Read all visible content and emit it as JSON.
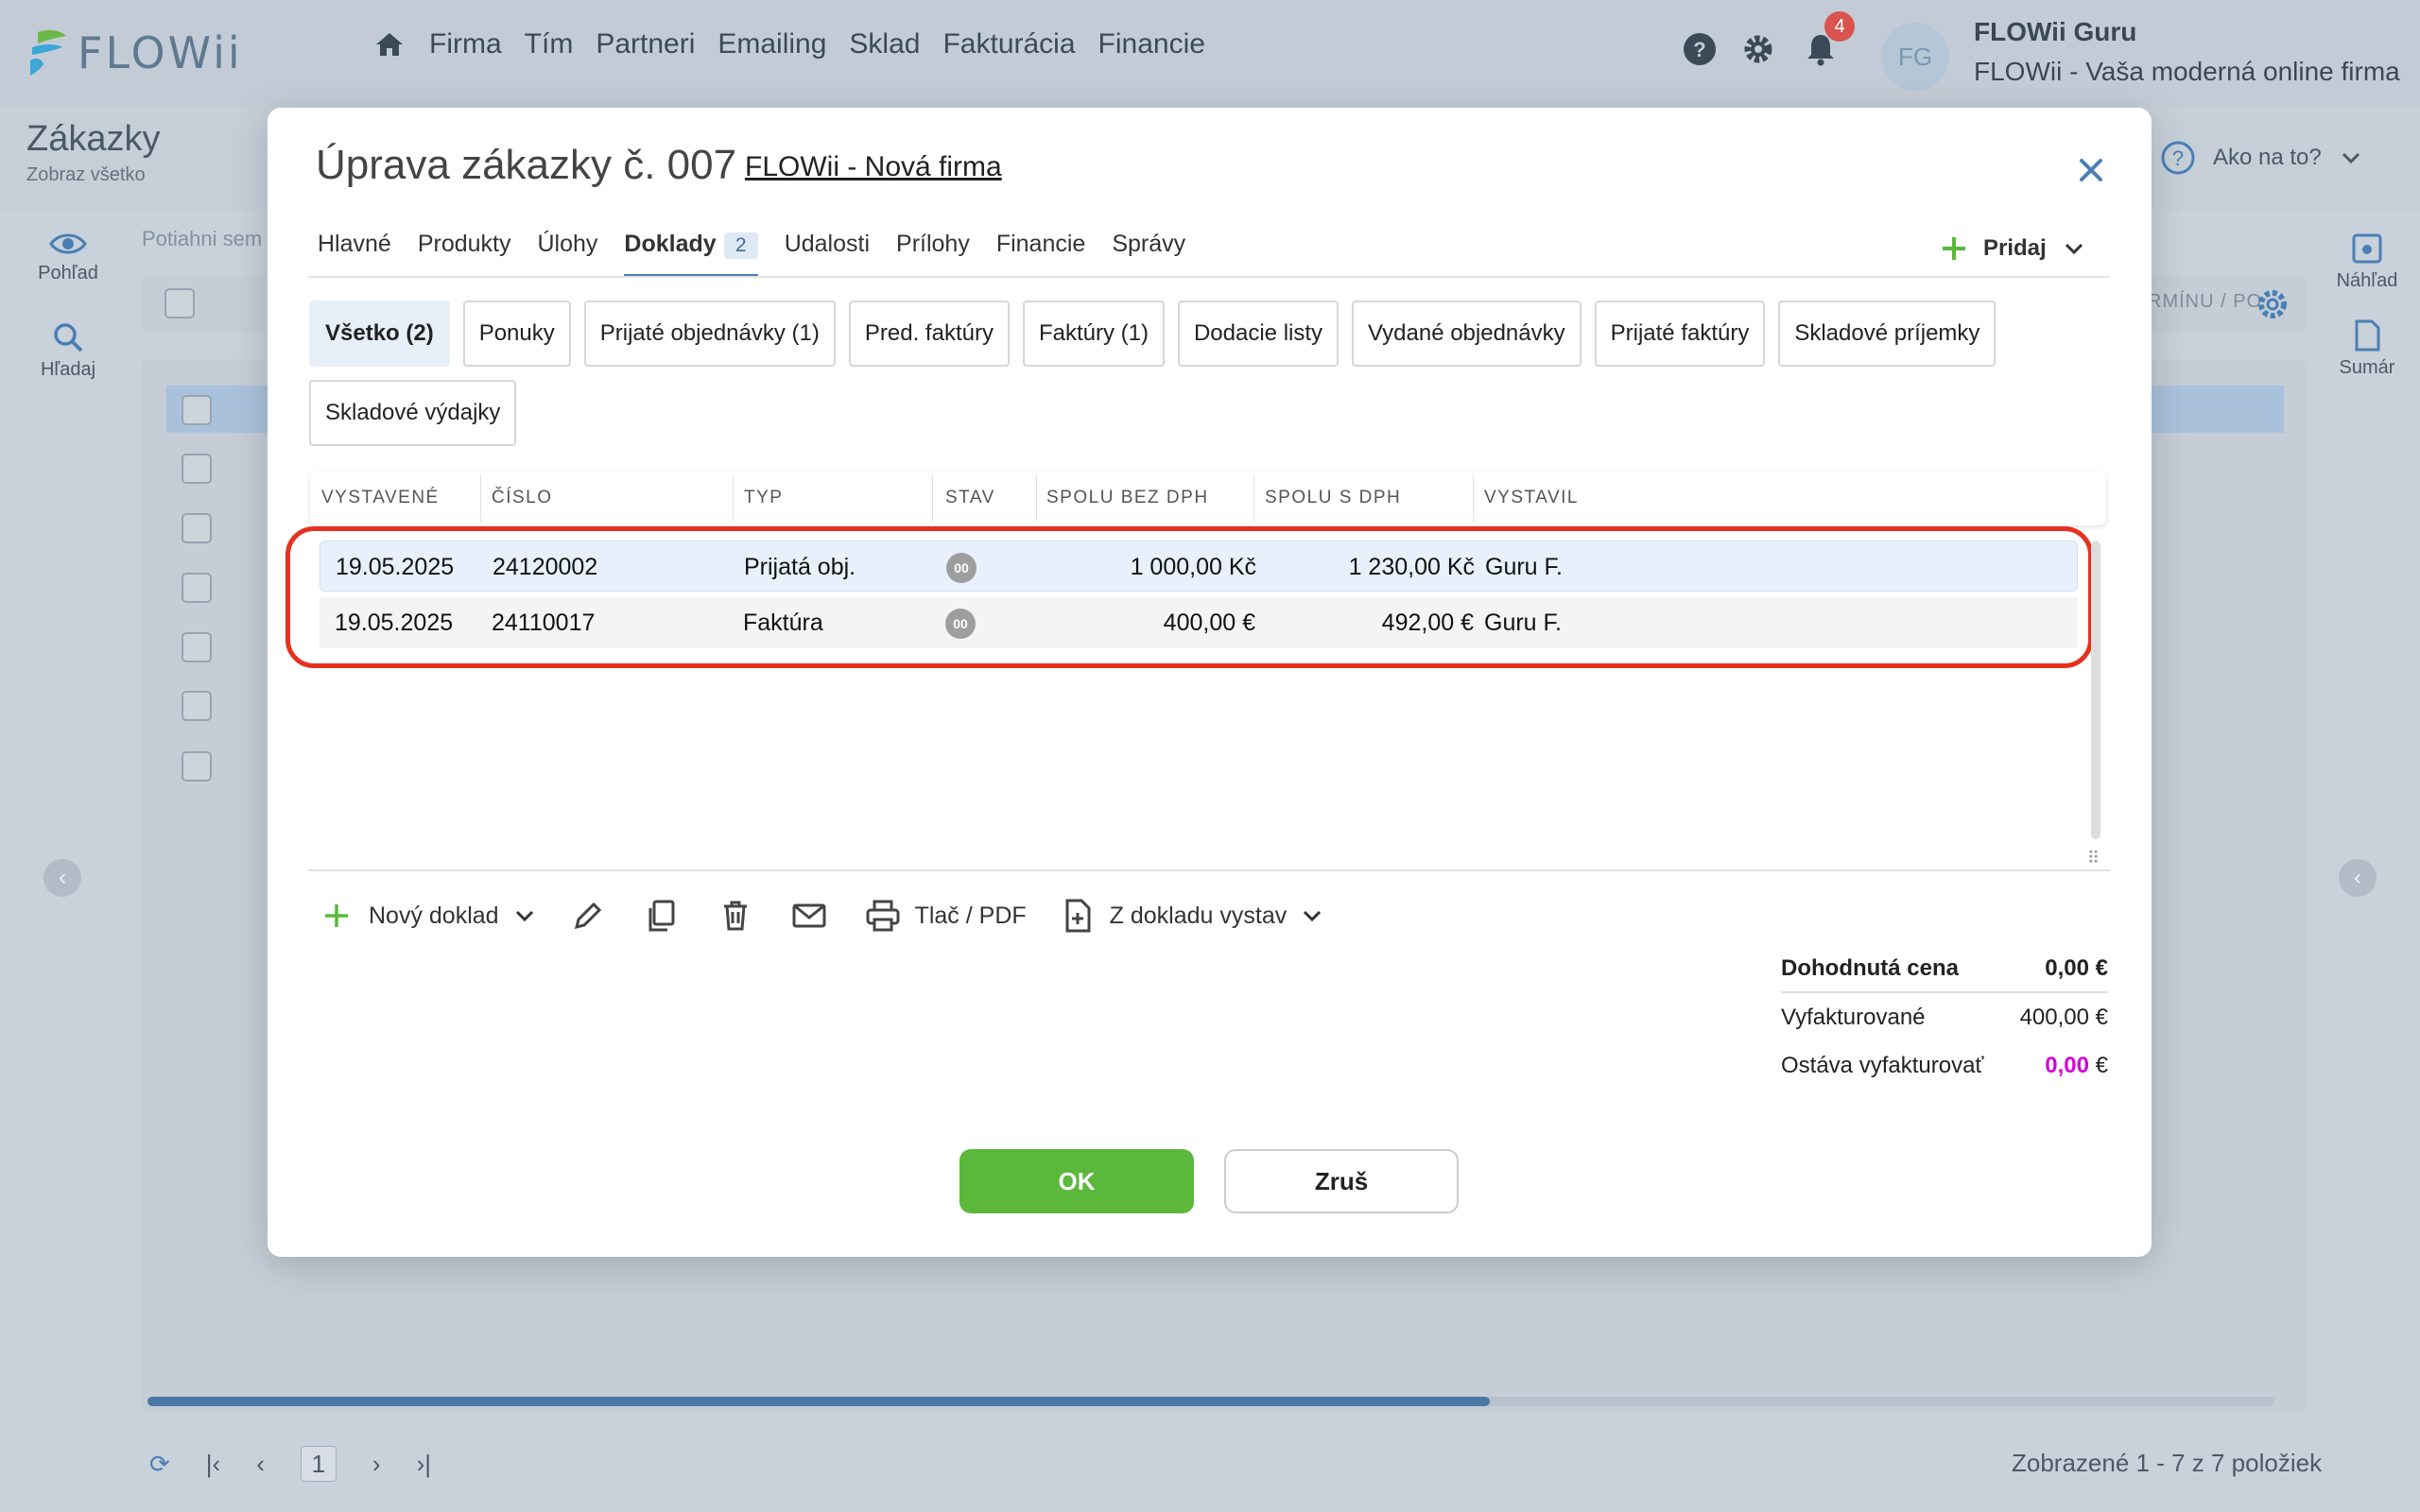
{
  "app": {
    "logo_text": "FLOWii",
    "nav": [
      "Firma",
      "Tím",
      "Partneri",
      "Emailing",
      "Sklad",
      "Fakturácia",
      "Financie"
    ],
    "notifications_count": "4",
    "avatar_initials": "FG",
    "user_name": "FLOWii Guru",
    "user_company": "FLOWii - Vaša moderná online firma"
  },
  "page": {
    "title": "Zákazky",
    "subtitle": "Zobraz všetko",
    "help_label": "Ako na to?",
    "left_rail": [
      "Pohľad",
      "Hľadaj"
    ],
    "right_rail": [
      "Náhľad",
      "Sumár"
    ],
    "drag_hint": "Potiahni sem",
    "column_fragment": "RMÍNU / PO",
    "pager_page": "1",
    "shown_text": "Zobrazené 1 - 7 z 7 položiek"
  },
  "modal": {
    "title": "Úprava zákazky č. 007",
    "firm": "FLOWii - Nová firma",
    "tabs": [
      {
        "label": "Hlavné"
      },
      {
        "label": "Produkty"
      },
      {
        "label": "Úlohy"
      },
      {
        "label": "Doklady",
        "count": "2"
      },
      {
        "label": "Udalosti"
      },
      {
        "label": "Prílohy"
      },
      {
        "label": "Financie"
      },
      {
        "label": "Správy"
      }
    ],
    "add_label": "Pridaj",
    "filters": [
      "Všetko (2)",
      "Ponuky",
      "Prijaté objednávky (1)",
      "Pred. faktúry",
      "Faktúry (1)",
      "Dodacie listy",
      "Vydané objednávky",
      "Prijaté faktúry",
      "Skladové príjemky",
      "Skladové výdajky"
    ],
    "columns": [
      "VYSTAVENÉ",
      "ČÍSLO",
      "TYP",
      "STAV",
      "SPOLU BEZ DPH",
      "SPOLU S DPH",
      "VYSTAVIL"
    ],
    "rows": [
      {
        "date": "19.05.2025",
        "number": "24120002",
        "type": "Prijatá obj.",
        "status": "00",
        "net": "1 000,00 Kč",
        "gross": "1 230,00 Kč",
        "author": "Guru F."
      },
      {
        "date": "19.05.2025",
        "number": "24110017",
        "type": "Faktúra",
        "status": "00",
        "net": "400,00 €",
        "gross": "492,00 €",
        "author": "Guru F."
      }
    ],
    "toolbar": {
      "new_doc": "Nový doklad",
      "print": "Tlač / PDF",
      "from_doc": "Z dokladu vystav"
    },
    "summary": {
      "agreed_label": "Dohodnutá cena",
      "agreed_value": "0,00 €",
      "invoiced_label": "Vyfakturované",
      "invoiced_value": "400,00 €",
      "remaining_label": "Ostáva vyfakturovať",
      "remaining_amount": "0,00",
      "remaining_currency": " €"
    },
    "ok_label": "OK",
    "cancel_label": "Zruš"
  },
  "colors": {
    "accent": "#4a7fb5",
    "ok_green": "#5bb83b",
    "highlight_red": "#e53220",
    "magenta": "#d400d4"
  }
}
